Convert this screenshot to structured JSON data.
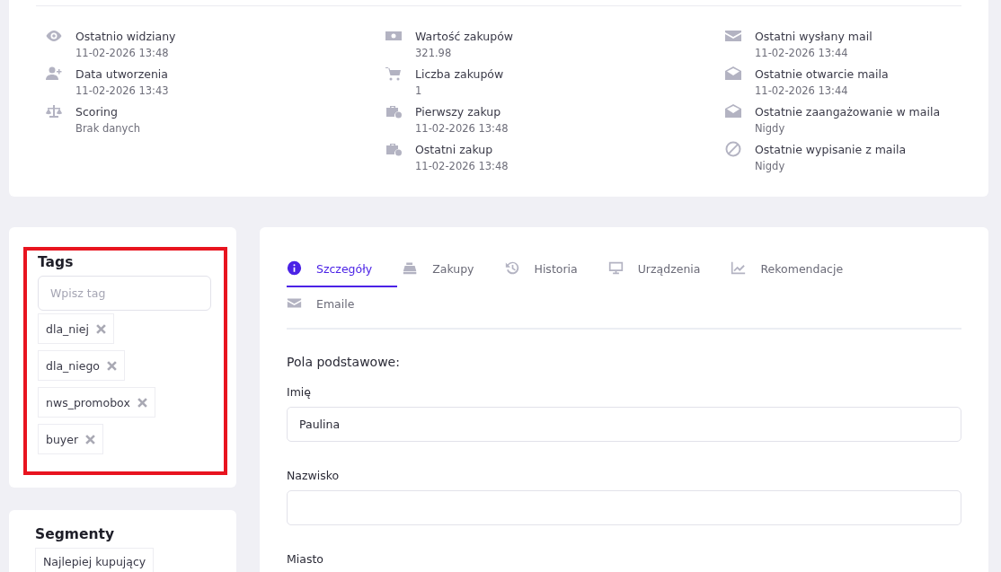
{
  "stat_columns": [
    [
      {
        "label": "Ostatnio widziany",
        "value": "11-02-2026 13:48"
      },
      {
        "label": "Data utworzenia",
        "value": "11-02-2026 13:43"
      },
      {
        "label": "Scoring",
        "value": "Brak danych"
      }
    ],
    [
      {
        "label": "Wartość zakupów",
        "value": "321.98"
      },
      {
        "label": "Liczba zakupów",
        "value": "1"
      },
      {
        "label": "Pierwszy zakup",
        "value": "11-02-2026 13:48"
      },
      {
        "label": "Ostatni zakup",
        "value": "11-02-2026 13:48"
      }
    ],
    [
      {
        "label": "Ostatni wysłany mail",
        "value": "11-02-2026 13:44"
      },
      {
        "label": "Ostatnie otwarcie maila",
        "value": "11-02-2026 13:44"
      },
      {
        "label": "Ostatnie zaangażowanie w maila",
        "value": "Nigdy"
      },
      {
        "label": "Ostatnie wypisanie z maila",
        "value": "Nigdy"
      }
    ]
  ],
  "tags": {
    "title": "Tags",
    "highlighted": true,
    "input": {
      "placeholder": "Wpisz tag"
    },
    "items": [
      "dla_niej",
      "dla_niego",
      "nws_promobox",
      "buyer"
    ]
  },
  "segments": {
    "title": "Segmenty",
    "items": [
      "Najlepiej kupujący"
    ]
  },
  "tabs": [
    {
      "label": "Szczegóły",
      "selected": true
    },
    {
      "label": "Zakupy",
      "selected": false
    },
    {
      "label": "Historia",
      "selected": false
    },
    {
      "label": "Urządzenia",
      "selected": false
    },
    {
      "label": "Rekomendacje",
      "selected": false
    },
    {
      "label": "Emaile",
      "selected": false
    }
  ],
  "section_title": "Pola podstawowe:",
  "fields": [
    {
      "label": "Imię",
      "value": "Paulina"
    },
    {
      "label": "Nazwisko"
    },
    {
      "label": "Miasto"
    }
  ]
}
